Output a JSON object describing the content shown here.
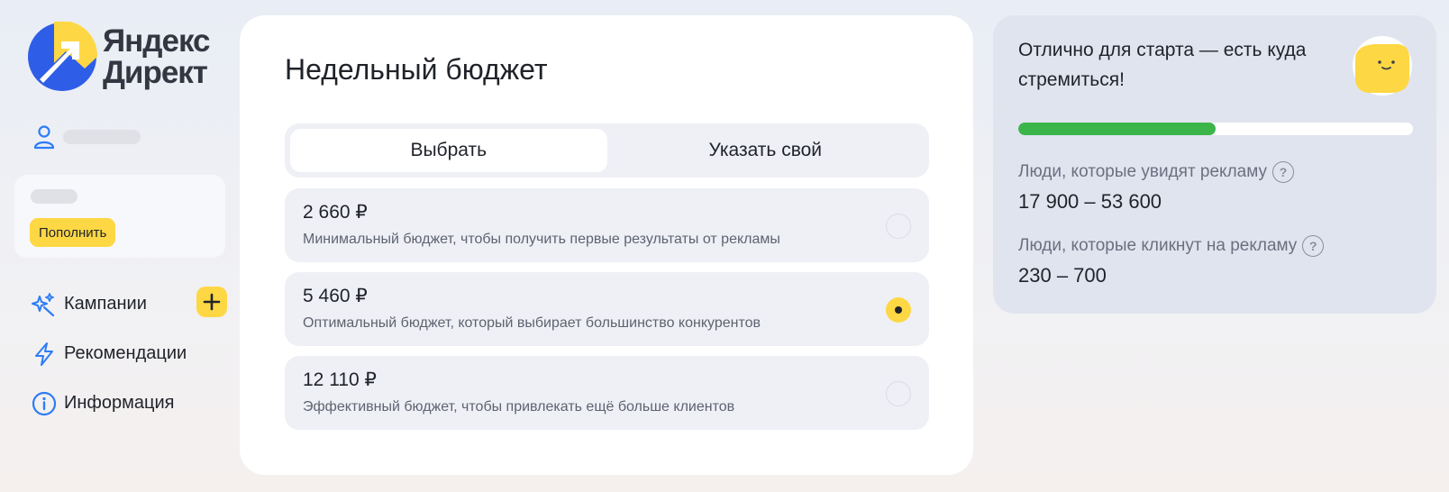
{
  "brand": {
    "line1": "Яндекс",
    "line2": "Директ"
  },
  "sidebar": {
    "topup_label": "Пополнить",
    "nav": [
      {
        "label": "Кампании",
        "icon": "sparkles-icon"
      },
      {
        "label": "Рекомендации",
        "icon": "lightning-icon"
      },
      {
        "label": "Информация",
        "icon": "info-icon"
      }
    ]
  },
  "main": {
    "title": "Недельный бюджет",
    "tabs": [
      {
        "label": "Выбрать",
        "active": true
      },
      {
        "label": "Указать свой",
        "active": false
      }
    ],
    "options": [
      {
        "price": "2 660 ₽",
        "description": "Минимальный бюджет, чтобы получить первые результаты от рекламы",
        "selected": false
      },
      {
        "price": "5 460 ₽",
        "description": "Оптимальный бюджет, который выбирает большинство конкурентов",
        "selected": true
      },
      {
        "price": "12 110 ₽",
        "description": "Эффективный бюджет, чтобы привлекать ещё больше клиентов",
        "selected": false
      }
    ]
  },
  "forecast": {
    "headline": "Отлично для старта — есть куда стремиться!",
    "progress_fraction": 0.5,
    "metrics": [
      {
        "label": "Люди, которые увидят рекламу",
        "value": "17 900 – 53 600"
      },
      {
        "label": "Люди, которые кликнут на рекламу",
        "value": "230 – 700"
      }
    ]
  },
  "colors": {
    "accent_yellow": "#fed744",
    "logo_blue": "#2e5ee8",
    "progress_green": "#3bb54a",
    "icon_blue": "#2d7cf6"
  }
}
